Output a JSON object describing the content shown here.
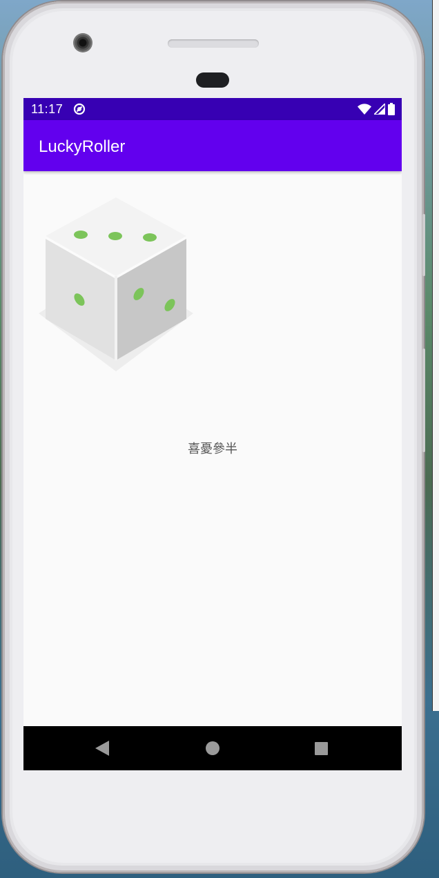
{
  "status_bar": {
    "time": "11:17",
    "icons": [
      "dnd-icon",
      "wifi-icon",
      "cellular-signal-icon",
      "battery-icon"
    ]
  },
  "app_bar": {
    "title": "LuckyRoller"
  },
  "main": {
    "dice_image": {
      "icon": "dice-icon",
      "dot_color": "#7cc45a"
    },
    "result_text": "喜憂參半"
  },
  "navigation": {
    "icons": [
      "back-icon",
      "home-icon",
      "recents-icon"
    ]
  },
  "colors": {
    "status_bar": "#3700b3",
    "app_bar": "#6200ee",
    "screen_background": "#fafafa",
    "nav_bar": "#000000"
  }
}
